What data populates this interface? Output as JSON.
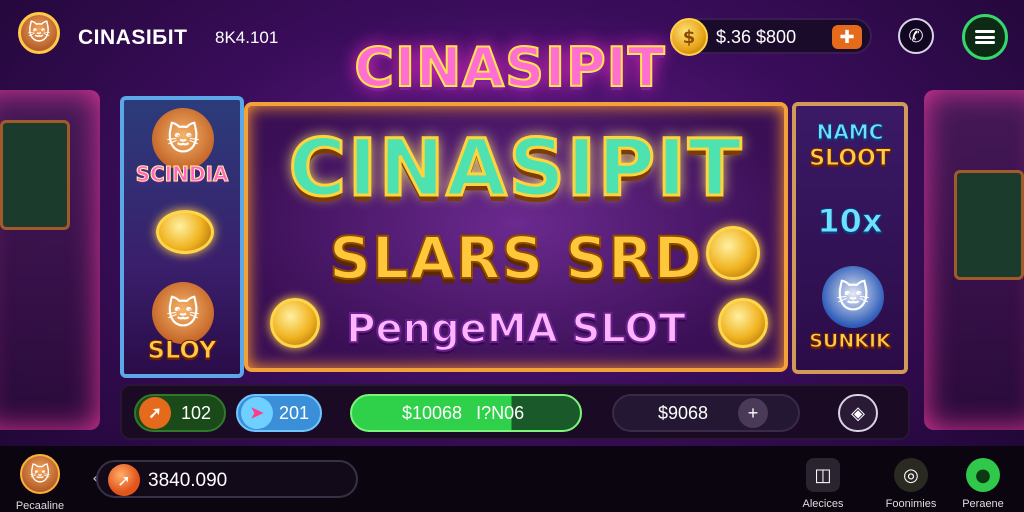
{
  "header": {
    "brand": "CINASIБIT",
    "brand_sub": "8K4.101",
    "balance": "$.36 $800",
    "add_symbol": "✚",
    "coin_symbol": "$",
    "support_symbol": "✆"
  },
  "hero": {
    "top_title": "CINASIPIT",
    "panel_title": "CINASIPIT",
    "panel_subtitle": "SLARS SRD",
    "panel_tagline": "PengeMA SLOT"
  },
  "side_left": {
    "label_top": "SCINDIA",
    "label_bottom": "SLOY"
  },
  "side_right": {
    "label_top_1": "NAMC",
    "label_top_2": "SLOOT",
    "multiplier": "10x",
    "label_bottom": "SUNKIK"
  },
  "action_bar": {
    "pill1_value": "102",
    "pill2_value": "201",
    "spin_value": "$10068",
    "spin_secondary": "I?N06",
    "total_value": "$9068",
    "plus_symbol": "+",
    "settings_symbol": "◈"
  },
  "footer": {
    "profile_label": "Pecaaline",
    "balance": "3840.090",
    "chevron": "‹",
    "nav": [
      {
        "label": "Alecices",
        "icon": "◫"
      },
      {
        "label": "Foonimies",
        "icon": "◎"
      },
      {
        "label": "Peraene",
        "icon": "●"
      }
    ]
  },
  "colors": {
    "accent_gold": "#ffc94a",
    "accent_green": "#37d66a",
    "accent_pink": "#ff6fd1",
    "background": "#3b0d5c"
  }
}
